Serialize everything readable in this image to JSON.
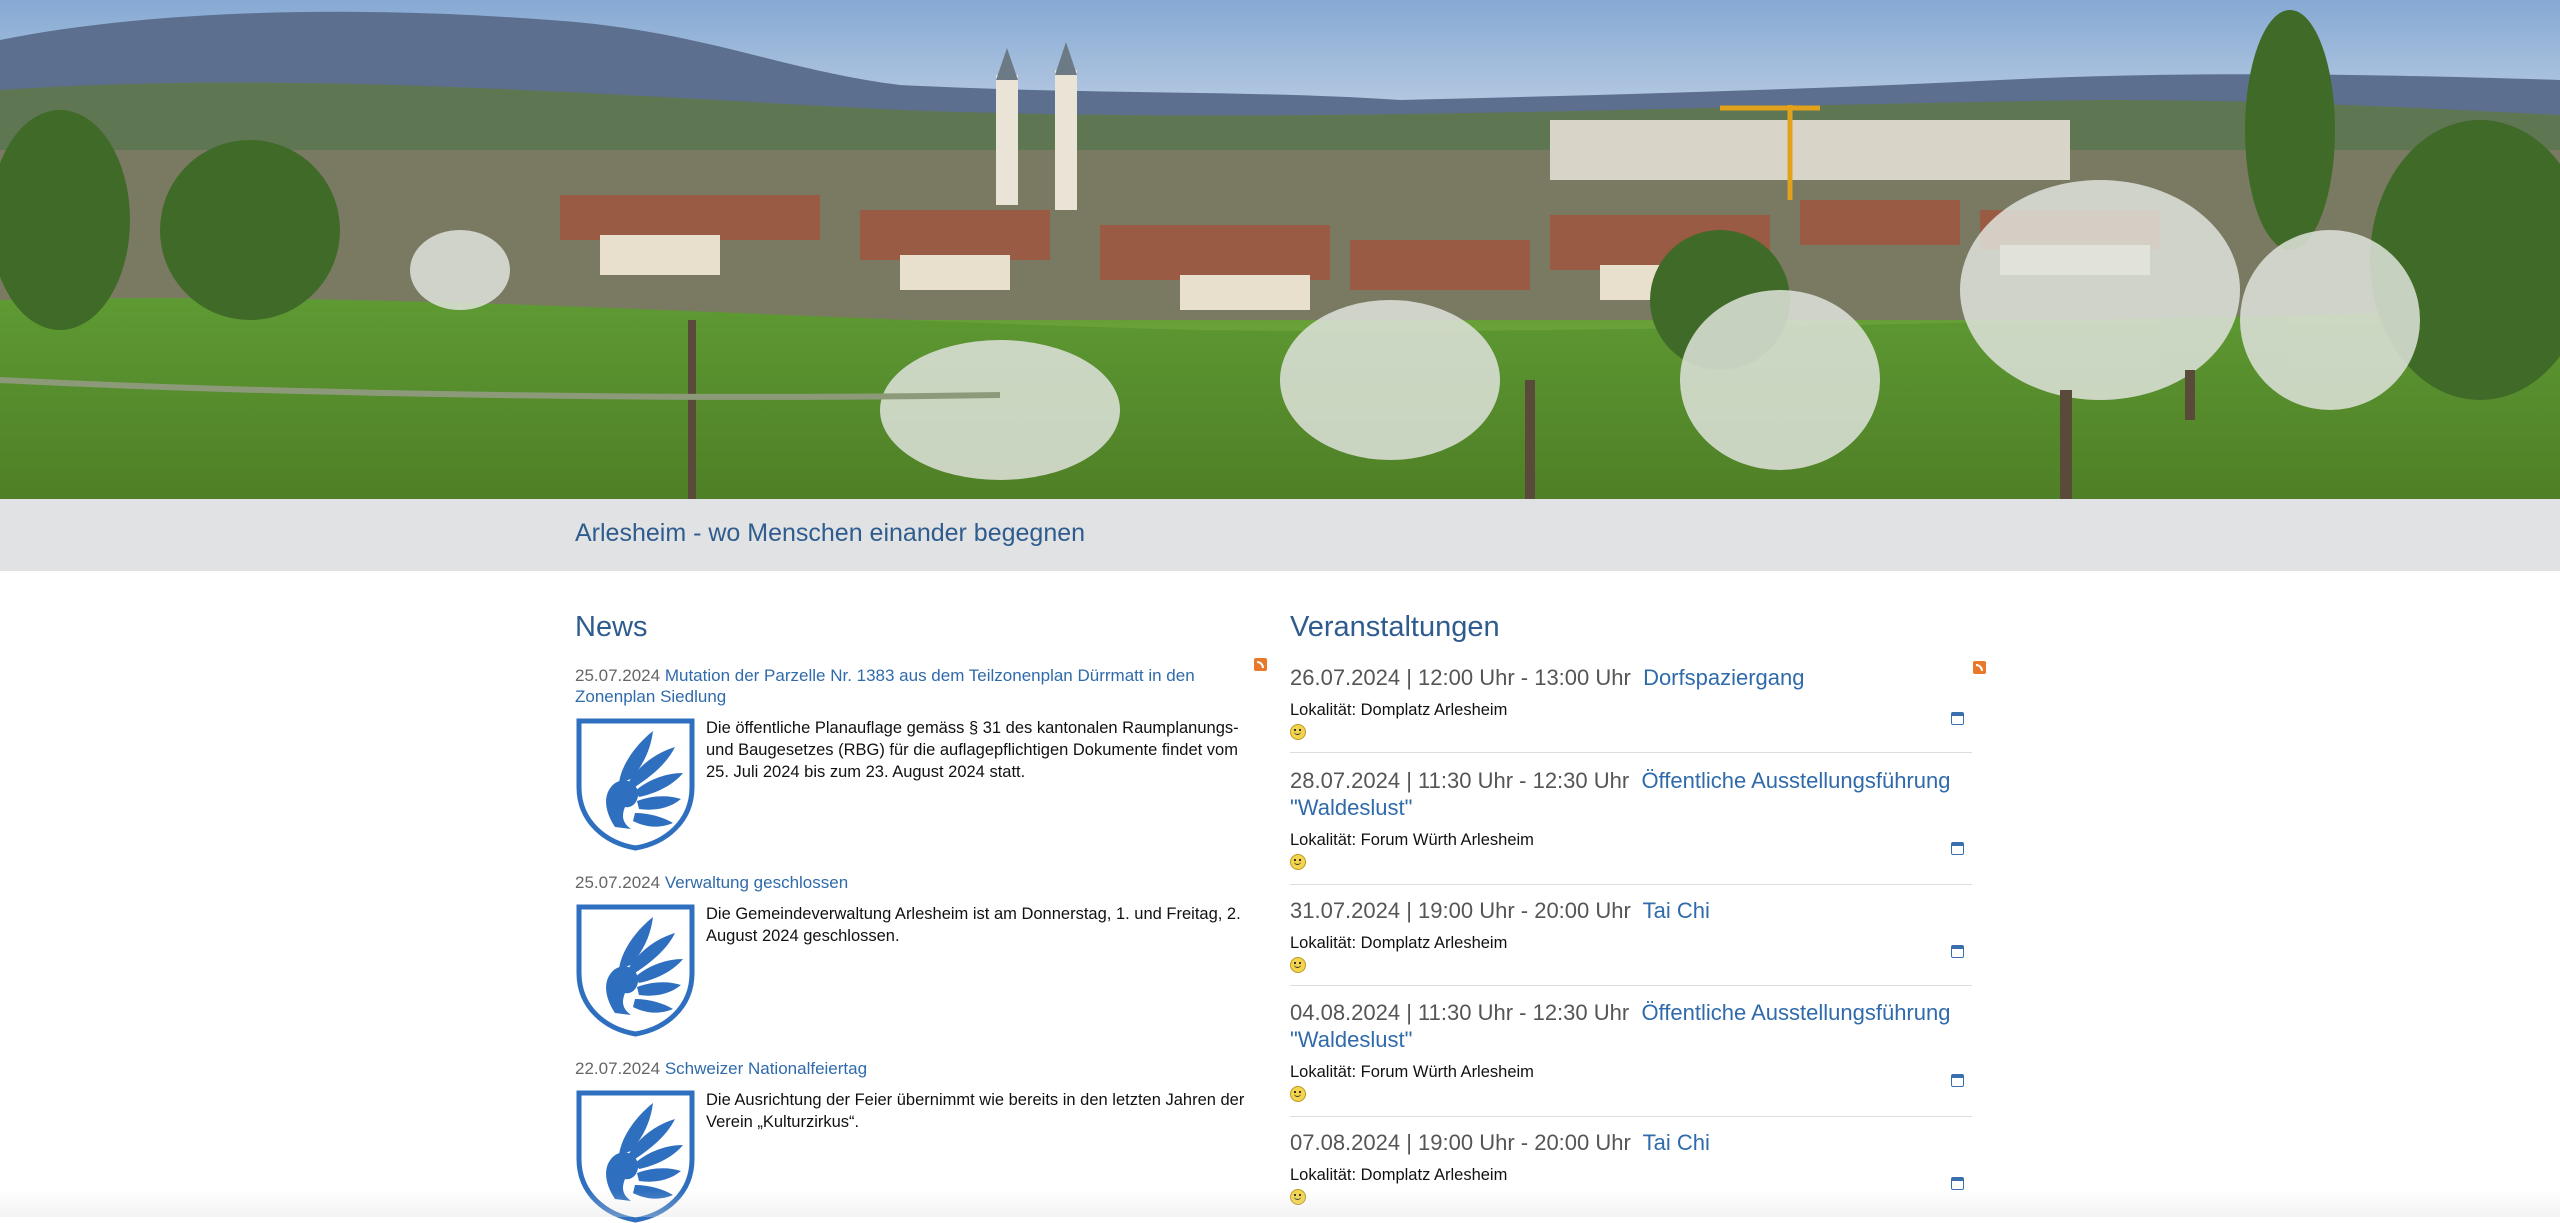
{
  "header": {
    "tagline": "Arlesheim - wo Menschen einander begegnen"
  },
  "news": {
    "title": "News",
    "items": [
      {
        "date": "25.07.2024",
        "title": "Mutation der Parzelle Nr. 1383 aus dem Teilzonenplan Dürrmatt in den Zonenplan Siedlung",
        "text": "Die öffentliche Planauflage gemäss § 31 des kantonalen Raumplanungs- und Baugesetzes (RBG) für die auflagepflichtigen Dokumente findet vom 25. Juli 2024 bis zum 23. August 2024 statt."
      },
      {
        "date": "25.07.2024",
        "title": "Verwaltung geschlossen",
        "text": "Die Gemeindeverwaltung Arlesheim ist am Donnerstag, 1. und Freitag, 2. August 2024 geschlossen."
      },
      {
        "date": "22.07.2024",
        "title": "Schweizer Nationalfeiertag",
        "text": "Die Ausrichtung der Feier übernimmt wie bereits in den letzten Jahren der Verein „Kulturzirkus“."
      }
    ]
  },
  "events": {
    "title": "Veranstaltungen",
    "items": [
      {
        "when": "26.07.2024 | 12:00 Uhr - 13:00 Uhr",
        "title": "Dorfspaziergang",
        "location": "Lokalität: Domplatz Arlesheim"
      },
      {
        "when": "28.07.2024 | 11:30 Uhr - 12:30 Uhr",
        "title": "Öffentliche Ausstellungsführung \"Waldeslust\"",
        "location": "Lokalität: Forum Würth Arlesheim"
      },
      {
        "when": "31.07.2024 | 19:00 Uhr - 20:00 Uhr",
        "title": "Tai Chi",
        "location": "Lokalität: Domplatz Arlesheim"
      },
      {
        "when": "04.08.2024 | 11:30 Uhr - 12:30 Uhr",
        "title": "Öffentliche Ausstellungsführung \"Waldeslust\"",
        "location": "Lokalität: Forum Würth Arlesheim"
      },
      {
        "when": "07.08.2024 | 19:00 Uhr - 20:00 Uhr",
        "title": "Tai Chi",
        "location": "Lokalität: Domplatz Arlesheim"
      }
    ]
  },
  "icons": {
    "rss": "rss-feed-icon",
    "calendar": "calendar-add-icon",
    "smiley": "smiley-icon",
    "crest": "arlesheim-coat-of-arms"
  },
  "colors": {
    "accent": "#2f5c8f",
    "link": "#2f6aab",
    "tagbar_bg": "#e1e2e3",
    "rss": "#e8782a",
    "crest_blue": "#2f6fbf"
  }
}
